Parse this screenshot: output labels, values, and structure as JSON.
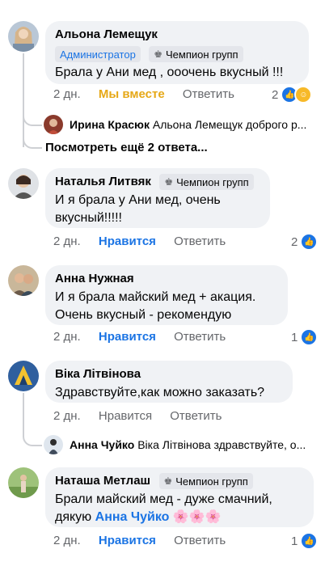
{
  "comments": [
    {
      "name": "Альона Лемещук",
      "admin_badge": "Администратор",
      "fan_badge": "Чемпион групп",
      "text": "Брала у Ани мед , ооочень вкусный !!!",
      "time": "2 дн.",
      "action1": "Мы вместе",
      "action2": "Ответить",
      "reactions": "2",
      "reaction_icons": [
        "like-icon",
        "care-icon"
      ]
    },
    {
      "name": "Наталья Литвяк",
      "fan_badge": "Чемпион групп",
      "text": "И я брала у Ани мед, очень вкусный!!!!!",
      "time": "2 дн.",
      "action1": "Нравится",
      "action2": "Ответить",
      "reactions": "2",
      "reaction_icons": [
        "like-icon"
      ]
    },
    {
      "name": "Анна Нужная",
      "text": "И я брала майский мед + акация. Очень вкусный - рекомендую",
      "time": "2 дн.",
      "action1": "Нравится",
      "action2": "Ответить",
      "reactions": "1",
      "reaction_icons": [
        "like-icon"
      ]
    },
    {
      "name": "Віка Літвінова",
      "text": "Здравствуйте,как можно заказать?",
      "time": "2 дн.",
      "action1": "Нравится",
      "action2": "Ответить"
    },
    {
      "name": "Наташа Метлаш",
      "fan_badge": "Чемпион групп",
      "text_before": "Брали майский мед - дуже смачний, дякую",
      "mention": "Анна Чуйко",
      "emoji": "🌸🌸🌸",
      "time": "2 дн.",
      "action1": "Нравится",
      "action2": "Ответить",
      "reactions": "1",
      "reaction_icons": [
        "like-icon"
      ]
    }
  ],
  "replies": [
    {
      "name": "Ирина Красюк",
      "text": "Альона Лемещук доброго р..."
    },
    {
      "name": "Анна Чуйко",
      "text": "Віка Літвінова здравствуйте, о..."
    }
  ],
  "more_replies": "Посмотреть ещё 2 ответа...",
  "colors": {
    "accent": "#1b74e4",
    "bubble": "#f0f2f5",
    "together": "#e6a817"
  }
}
